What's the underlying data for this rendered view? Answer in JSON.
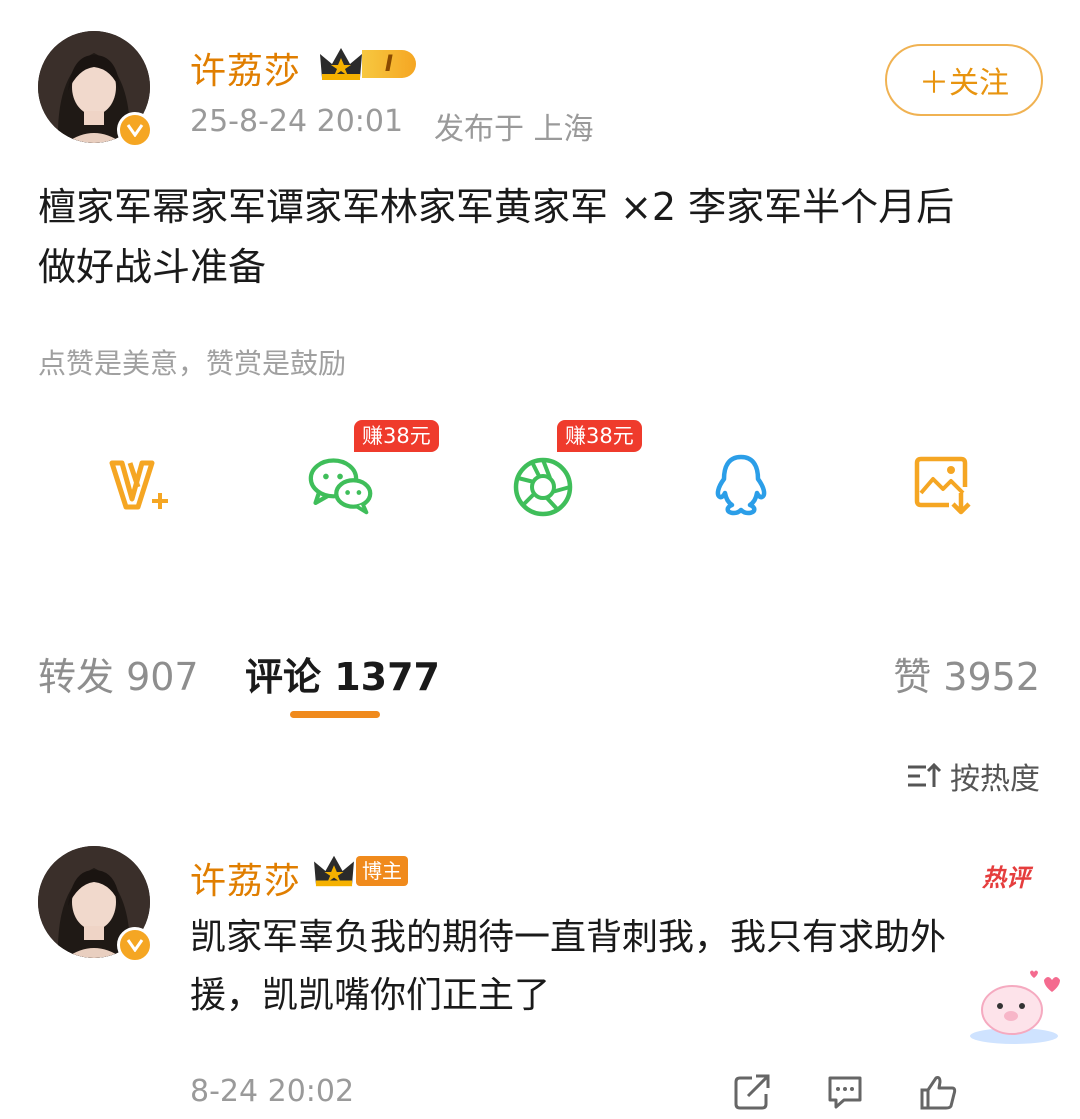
{
  "post": {
    "author": "许荔莎",
    "level_badge": "I",
    "timestamp": "25-8-24 20:01",
    "location": "发布于 上海",
    "follow_label": "＋关注",
    "text_line1": "檀家军幂家军谭家军林家军黄家军 ×2 李家军半个月后",
    "text_line2": "做好战斗准备",
    "reward_hint": "点赞是美意，赞赏是鼓励"
  },
  "share": {
    "icons": [
      "vplus-icon",
      "wechat-icon",
      "moments-icon",
      "qq-icon",
      "save-image-icon"
    ],
    "earn_badge_1": "赚38元",
    "earn_badge_2": "赚38元",
    "colors": {
      "orange": "#f5a623",
      "green": "#3fbe5a",
      "blue": "#2b9ee8",
      "red": "#ef3b2c"
    }
  },
  "tabs": {
    "repost": "转发 907",
    "comments": "评论 1377",
    "likes": "赞 3952"
  },
  "sort": {
    "label": "按热度",
    "icon": "sort-icon"
  },
  "comment": {
    "author": "许荔莎",
    "tag": "博主",
    "hot_label": "热评",
    "text_line1": "凯家军辜负我的期待一直背刺我，我只有求助外",
    "text_line2": "援，凯凯嘴你们正主了",
    "timestamp": "8-24 20:02",
    "actions": [
      "share-icon",
      "comment-icon",
      "like-icon"
    ]
  }
}
